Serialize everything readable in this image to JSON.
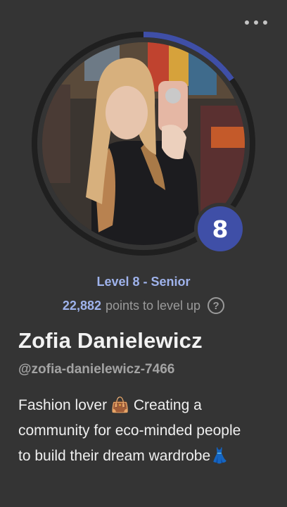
{
  "profile": {
    "level_number": "8",
    "level_title": "Level 8 - Senior",
    "points_value": "22,882",
    "points_suffix": "points to level up",
    "help_glyph": "?",
    "name": "Zofia Danielewicz",
    "handle": "@zofia-danielewicz-7466",
    "bio": "Fashion lover 👜 Creating a community for eco-minded people to build their dream wardrobe👗",
    "level_progress_fraction": 0.15
  },
  "icons": {
    "more": "more-horizontal-icon",
    "help": "help-circle-icon"
  },
  "colors": {
    "accent": "#3f4fa7",
    "level_text": "#9fb3ec",
    "background": "#343434"
  }
}
